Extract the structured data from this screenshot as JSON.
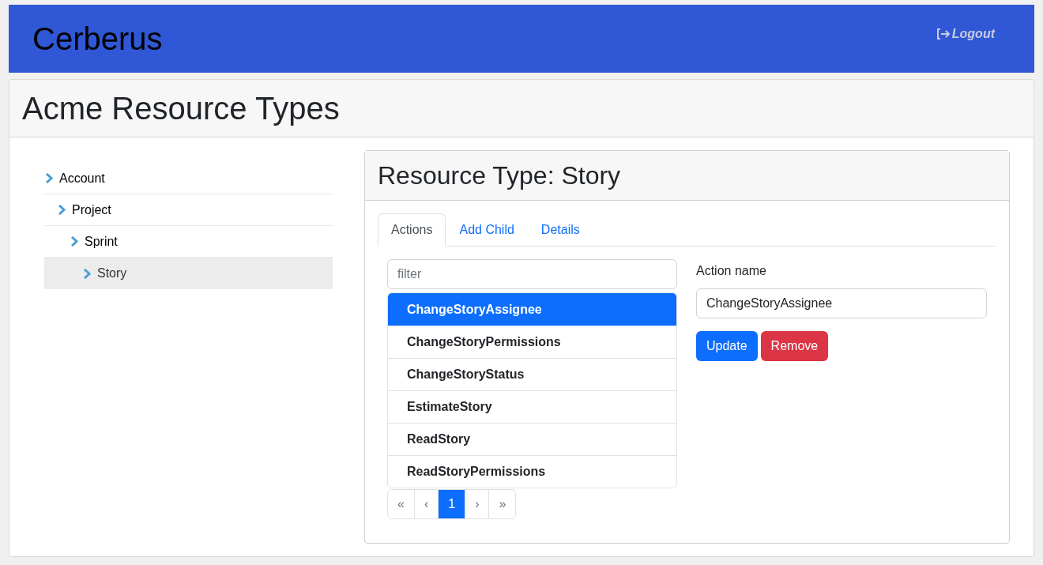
{
  "app_title": "Cerberus",
  "logout": "Logout",
  "page_title": "Acme Resource Types",
  "tree": [
    {
      "label": "Account",
      "selected": false,
      "children": [
        {
          "label": "Project",
          "selected": false,
          "children": [
            {
              "label": "Sprint",
              "selected": false,
              "children": [
                {
                  "label": "Story",
                  "selected": true
                }
              ]
            }
          ]
        }
      ]
    }
  ],
  "panel_title": "Resource Type: Story",
  "tabs": [
    {
      "label": "Actions",
      "selected": true
    },
    {
      "label": "Add Child",
      "selected": false
    },
    {
      "label": "Details",
      "selected": false
    }
  ],
  "filter": {
    "placeholder": "filter"
  },
  "actions": [
    {
      "label": "ChangeStoryAssignee",
      "selected": true
    },
    {
      "label": "ChangeStoryPermissions",
      "selected": false
    },
    {
      "label": "ChangeStoryStatus",
      "selected": false
    },
    {
      "label": "EstimateStory",
      "selected": false
    },
    {
      "label": "ReadStory",
      "selected": false
    },
    {
      "label": "ReadStoryPermissions",
      "selected": false
    }
  ],
  "pagination": [
    {
      "label": "«",
      "selected": false
    },
    {
      "label": "‹",
      "selected": false
    },
    {
      "label": "1",
      "selected": true
    },
    {
      "label": "›",
      "selected": false
    },
    {
      "label": "»",
      "selected": false
    }
  ],
  "action_name": {
    "label": "Action name",
    "value": "ChangeStoryAssignee"
  },
  "buttons": [
    {
      "label": "Update",
      "kind": "primary"
    },
    {
      "label": "Remove",
      "kind": "danger"
    }
  ]
}
